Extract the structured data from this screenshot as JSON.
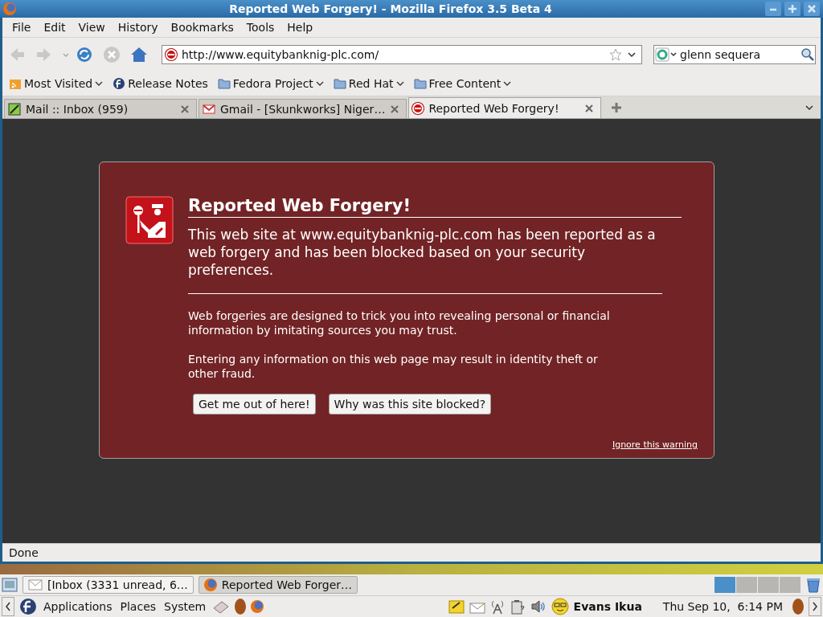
{
  "window": {
    "title": "Reported Web Forgery! - Mozilla Firefox 3.5 Beta 4"
  },
  "menu": [
    "File",
    "Edit",
    "View",
    "History",
    "Bookmarks",
    "Tools",
    "Help"
  ],
  "nav": {
    "url": "http://www.equitybanknig-plc.com/",
    "search": "glenn sequera"
  },
  "bookmarks": [
    {
      "label": "Most Visited",
      "kind": "feed",
      "dropdown": true
    },
    {
      "label": "Release Notes",
      "kind": "fedora",
      "dropdown": false
    },
    {
      "label": "Fedora Project",
      "kind": "folder",
      "dropdown": true
    },
    {
      "label": "Red Hat",
      "kind": "folder",
      "dropdown": true
    },
    {
      "label": "Free Content",
      "kind": "folder",
      "dropdown": true
    }
  ],
  "tabs": [
    {
      "label": "Mail :: Inbox (959)",
      "kind": "mail",
      "selected": false
    },
    {
      "label": "Gmail - [Skunkworks] Niger…",
      "kind": "gmail",
      "selected": false
    },
    {
      "label": "Reported Web Forgery!",
      "kind": "blocked",
      "selected": true
    }
  ],
  "page": {
    "title": "Reported Web Forgery!",
    "lead": "This web site at www.equitybanknig-plc.com has been reported as a web forgery and has been blocked based on your security preferences.",
    "paragraphs": [
      "Web forgeries are designed to trick you into revealing personal or financial information by imitating sources you may trust.",
      "Entering any information on this web page may result in identity theft or other fraud."
    ],
    "buttons": [
      "Get me out of here!",
      "Why was this site blocked?"
    ],
    "link": "Ignore this warning"
  },
  "status_bar": "Done",
  "taskbar": [
    {
      "label": "[Inbox (3331 unread, 6…",
      "kind": "mail",
      "selected": false
    },
    {
      "label": "Reported Web Forger…",
      "kind": "firefox",
      "selected": true
    }
  ],
  "panel": {
    "menus": [
      "Applications",
      "Places",
      "System"
    ],
    "user": "Evans Ikua",
    "clock": "Thu Sep 10,  6:14 PM"
  }
}
